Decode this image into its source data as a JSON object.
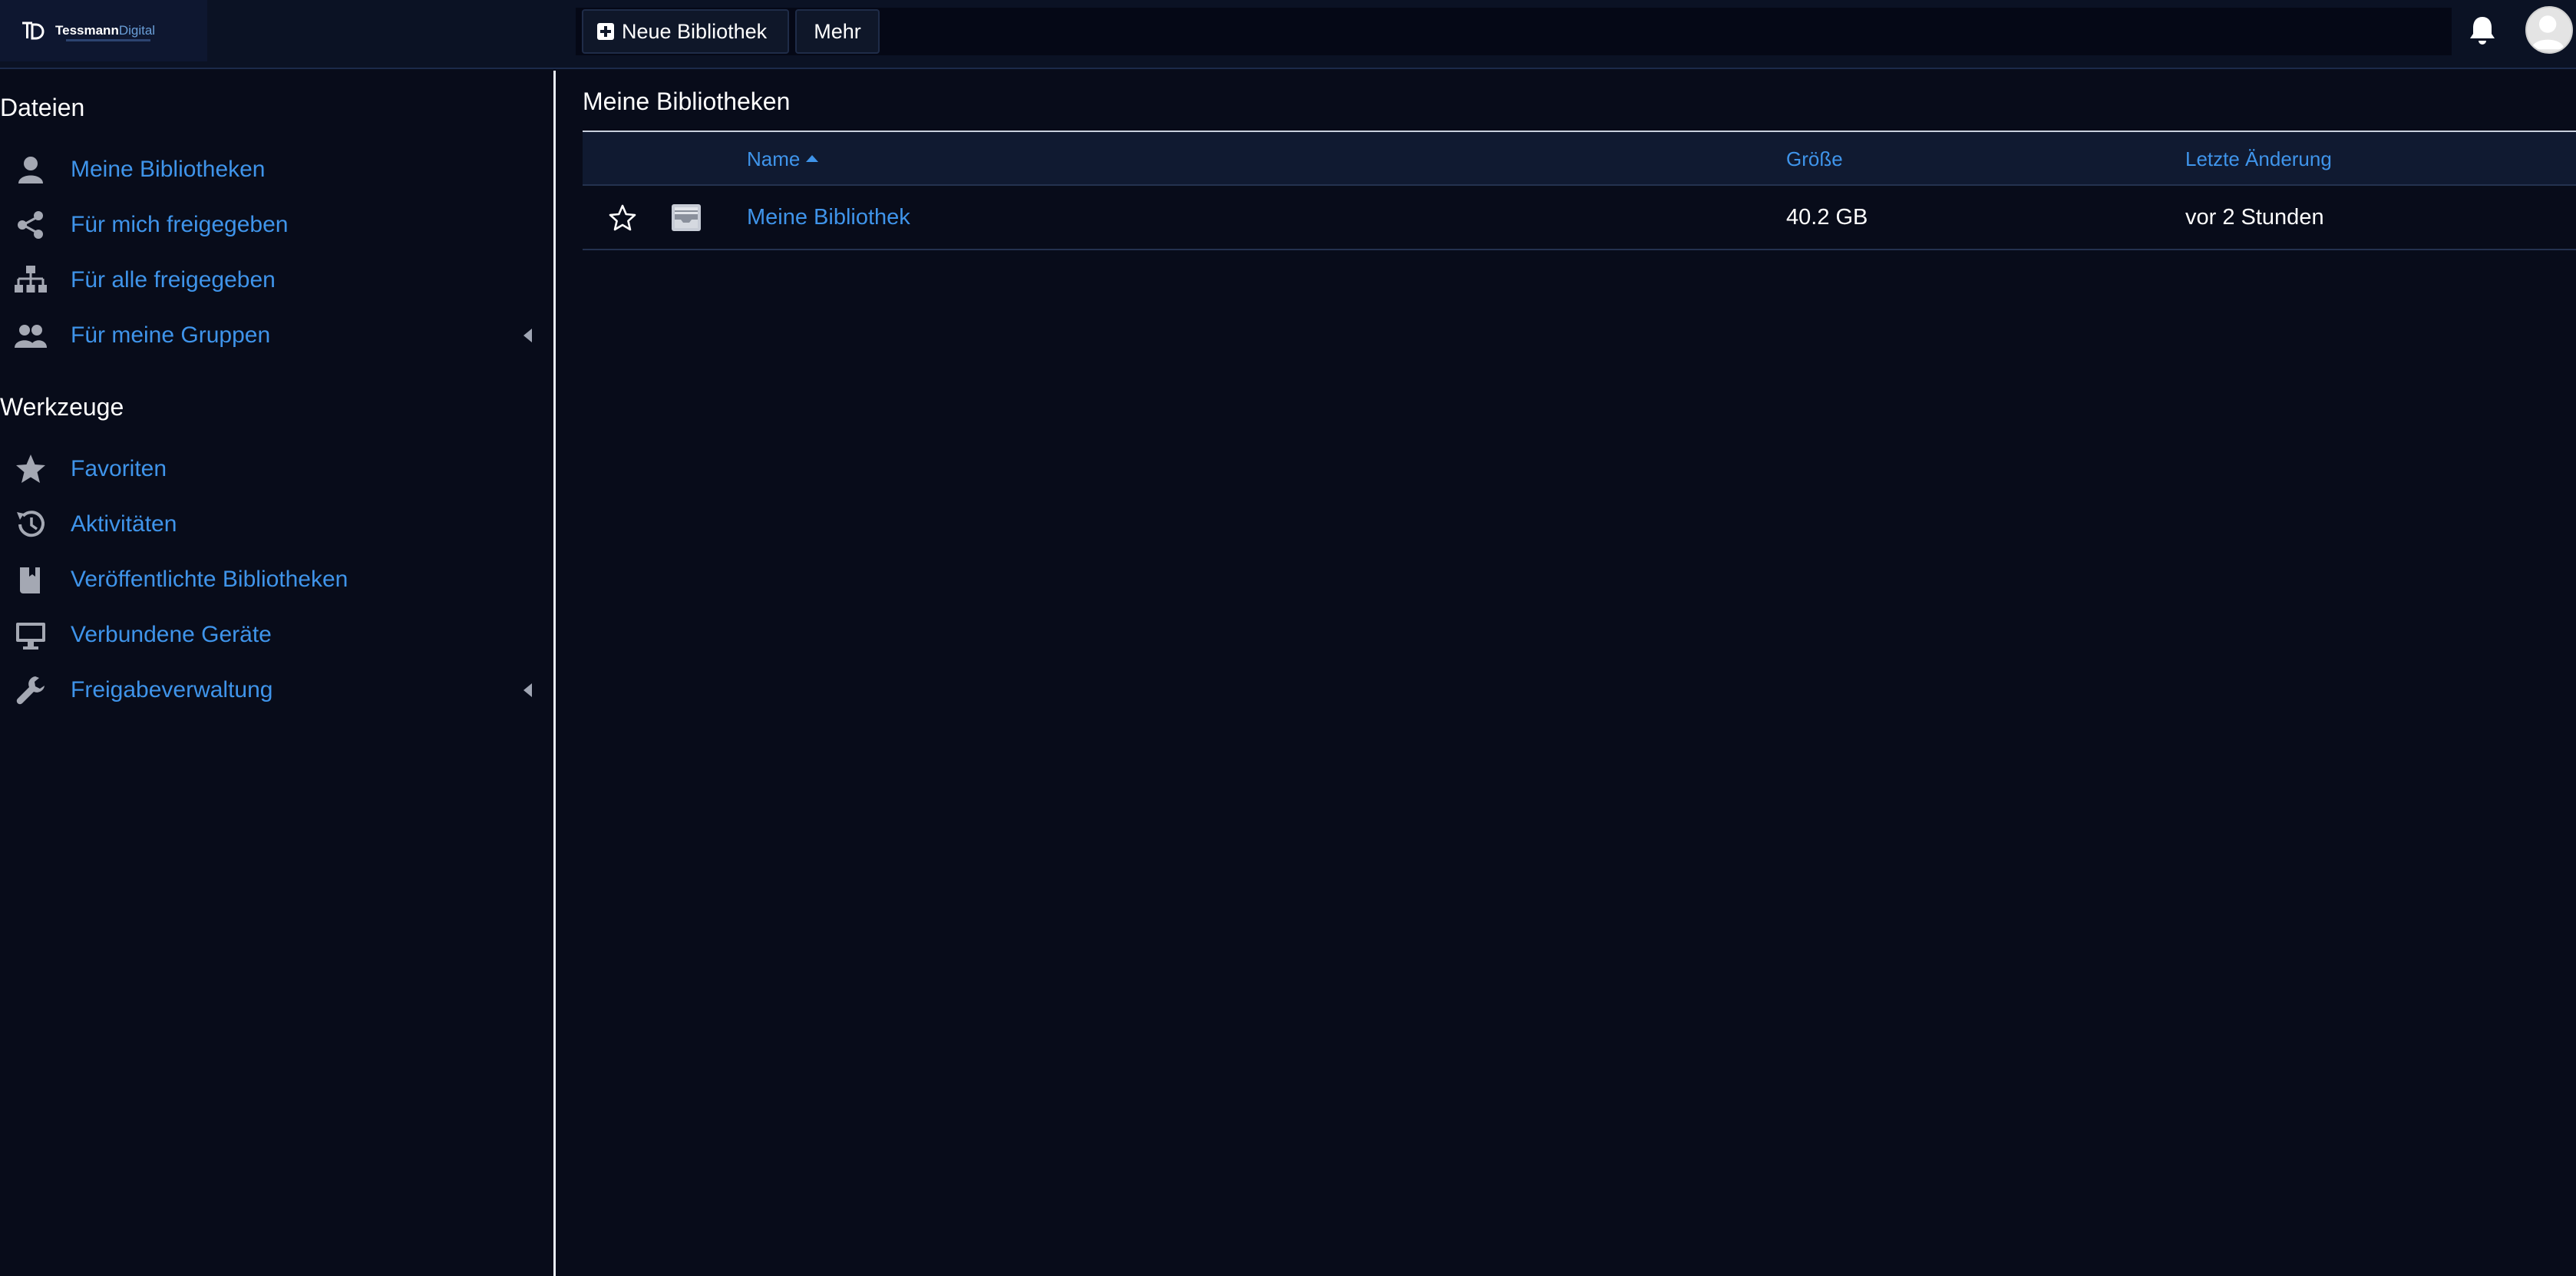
{
  "header": {
    "logo": {
      "mark": "TD",
      "name_part1": "Tessmann",
      "name_part2": "Digital"
    },
    "new_library_label": "Neue Bibliothek",
    "more_label": "Mehr",
    "icons": {
      "new": "plus-square-icon",
      "notifications": "bell-icon",
      "user": "avatar"
    }
  },
  "sidebar": {
    "sections": [
      {
        "title": "Dateien",
        "items": [
          {
            "label": "Meine Bibliotheken",
            "icon": "user-icon"
          },
          {
            "label": "Für mich freigegeben",
            "icon": "share-icon"
          },
          {
            "label": "Für alle freigegeben",
            "icon": "sitemap-icon"
          },
          {
            "label": "Für meine Gruppen",
            "icon": "group-icon",
            "expandable": true
          }
        ]
      },
      {
        "title": "Werkzeuge",
        "items": [
          {
            "label": "Favoriten",
            "icon": "star-icon"
          },
          {
            "label": "Aktivitäten",
            "icon": "history-icon"
          },
          {
            "label": "Veröffentlichte Bibliotheken",
            "icon": "book-icon"
          },
          {
            "label": "Verbundene Geräte",
            "icon": "monitor-icon"
          },
          {
            "label": "Freigabeverwaltung",
            "icon": "wrench-icon",
            "expandable": true
          }
        ]
      }
    ]
  },
  "main": {
    "title": "Meine Bibliotheken",
    "columns": {
      "name": "Name",
      "size": "Größe",
      "modified": "Letzte Änderung"
    },
    "sort": {
      "column": "name",
      "direction": "ascending"
    },
    "rows": [
      {
        "name": "Meine Bibliothek",
        "size": "40.2 GB",
        "modified": "vor 2 Stunden",
        "favorite": false,
        "icon": "library-icon"
      }
    ]
  },
  "colors": {
    "background": "#080c1a",
    "link": "#3f94ea",
    "header": "#0b1224",
    "table_header": "#101a31",
    "divider": "#e9eef8"
  }
}
